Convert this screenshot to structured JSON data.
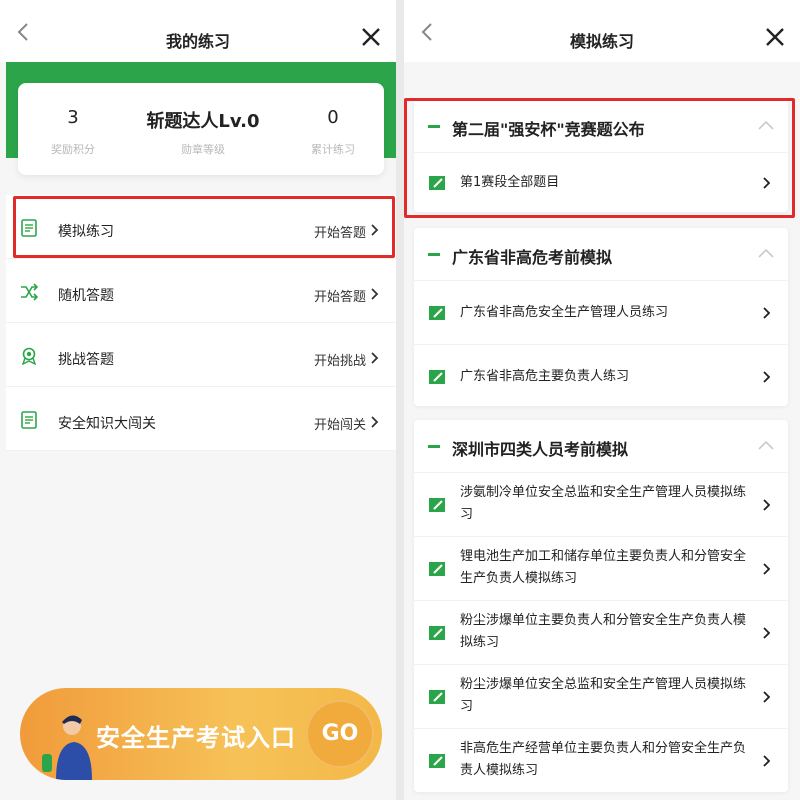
{
  "left": {
    "nav": {
      "title": "我的练习"
    },
    "stats": [
      {
        "value": "3",
        "label": "奖励积分"
      },
      {
        "value": "斩题达人Lv.0",
        "label": "勋章等级"
      },
      {
        "value": "0",
        "label": "累计练习"
      }
    ],
    "menu": [
      {
        "label": "模拟练习",
        "action": "开始答题",
        "icon": "doc-list-icon"
      },
      {
        "label": "随机答题",
        "action": "开始答题",
        "icon": "shuffle-icon"
      },
      {
        "label": "挑战答题",
        "action": "开始挑战",
        "icon": "medal-icon"
      },
      {
        "label": "安全知识大闯关",
        "action": "开始闯关",
        "icon": "doc-list-icon"
      }
    ],
    "banner": {
      "text": "安全生产考试入口",
      "go": "GO"
    }
  },
  "right": {
    "nav": {
      "title": "模拟练习"
    },
    "sections": [
      {
        "title": "第二届\"强安杯\"竞赛题公布",
        "items": [
          "第1赛段全部题目"
        ]
      },
      {
        "title": "广东省非高危考前模拟",
        "items": [
          "广东省非高危安全生产管理人员练习",
          "广东省非高危主要负责人练习"
        ]
      },
      {
        "title": "深圳市四类人员考前模拟",
        "items": [
          "涉氨制冷单位安全总监和安全生产管理人员模拟练习",
          "锂电池生产加工和储存单位主要负责人和分管安全生产负责人模拟练习",
          "粉尘涉爆单位主要负责人和分管安全生产负责人模拟练习",
          "粉尘涉爆单位安全总监和安全生产管理人员模拟练习",
          "非高危生产经营单位主要负责人和分管安全生产负责人模拟练习"
        ]
      }
    ]
  },
  "colors": {
    "accent_green": "#2ca54a",
    "highlight_red": "#e12b2b",
    "banner_orange": "#f3b847"
  }
}
